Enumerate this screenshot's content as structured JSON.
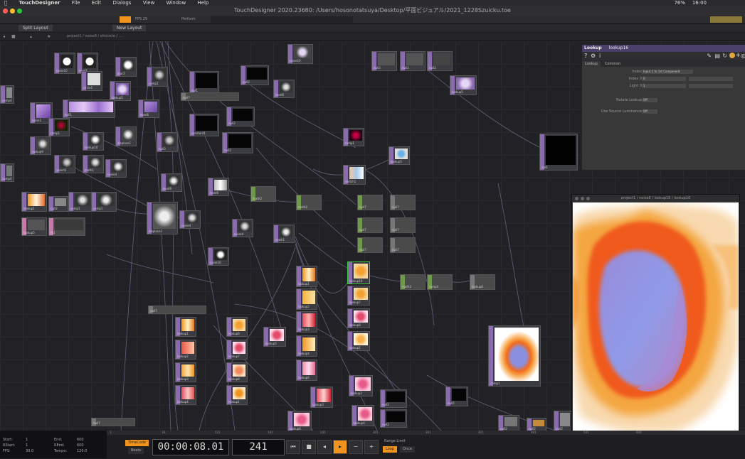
{
  "menubar": {
    "app_name": "TouchDesigner",
    "items": [
      "File",
      "Edit",
      "Dialogs",
      "View",
      "Window",
      "Help"
    ],
    "battery": "76%",
    "clock": "16:00"
  },
  "window": {
    "title": "TouchDesigner 2020.23680: /Users/hosonotatsuya/Desktop/平面ビジュアル/2021_1228Szuicku.toe"
  },
  "toolbar": {
    "perform_label": "Perform",
    "fps_label": "FPS",
    "fps_value": "29",
    "split_layout_label": "Split Layout",
    "new_layout_label": "New Layout",
    "path": "project1 / noise8 / shtcircle / ..."
  },
  "param_panel": {
    "op_type": "Lookup",
    "op_name": "lookup16",
    "tabs": [
      "Lookup",
      "Common"
    ],
    "rows": [
      {
        "label": "Index",
        "value": "Input 2 to 1st Component"
      },
      {
        "label": "Index 0",
        "value": "0"
      },
      {
        "label": "Light 0",
        "value": "1"
      },
      {
        "label": "Rotate Lookup",
        "value": "Off"
      },
      {
        "label": "Use Source Luminance",
        "value": "Off"
      }
    ]
  },
  "viewer": {
    "title": "project1 / noise8 / lookup16 / lookup16"
  },
  "timeline": {
    "timecode": "00:00:08.01",
    "frame": "241",
    "timecode_button": "TimeCode",
    "beats_button": "Beats",
    "range_label": "Range Limit",
    "loop_button": "Loop",
    "once_button": "Once",
    "ruler_ticks": [
      "1",
      "61",
      "121",
      "181",
      "241",
      "301",
      "361",
      "421",
      "481",
      "541",
      "600"
    ],
    "info": {
      "start_label": "Start:",
      "start_value": "1",
      "end_label": "End:",
      "end_value": "600",
      "rstart_label": "RStart:",
      "rstart_value": "1",
      "rend_label": "REnd:",
      "rend_value": "600",
      "fps_label": "FPS:",
      "fps_value": "30.0",
      "tempo_label": "Tempo:",
      "tempo_value": "120.0"
    }
  },
  "nodes": [
    "noise10",
    "level1",
    "circle1",
    "blur3",
    "comp1",
    "lookup5",
    "noise1",
    "null1",
    "ramp1",
    "level6",
    "displace1",
    "lookup9",
    "lookup10",
    "null3",
    "select1",
    "math1",
    "noise4",
    "comp4",
    "lookup16",
    "out1",
    "null2",
    "constant1",
    "lookup1",
    "lookup2",
    "lookup3",
    "lookup4",
    "lookup6",
    "lookup7",
    "lookup8",
    "null7",
    "switch1",
    "math2",
    "ramp4",
    "fit1"
  ],
  "colors": {
    "accent": "#f0941e",
    "top_node": "#8b6bb0",
    "chop_node": "#6f9a4a",
    "panel_header": "#4a3f6a"
  }
}
